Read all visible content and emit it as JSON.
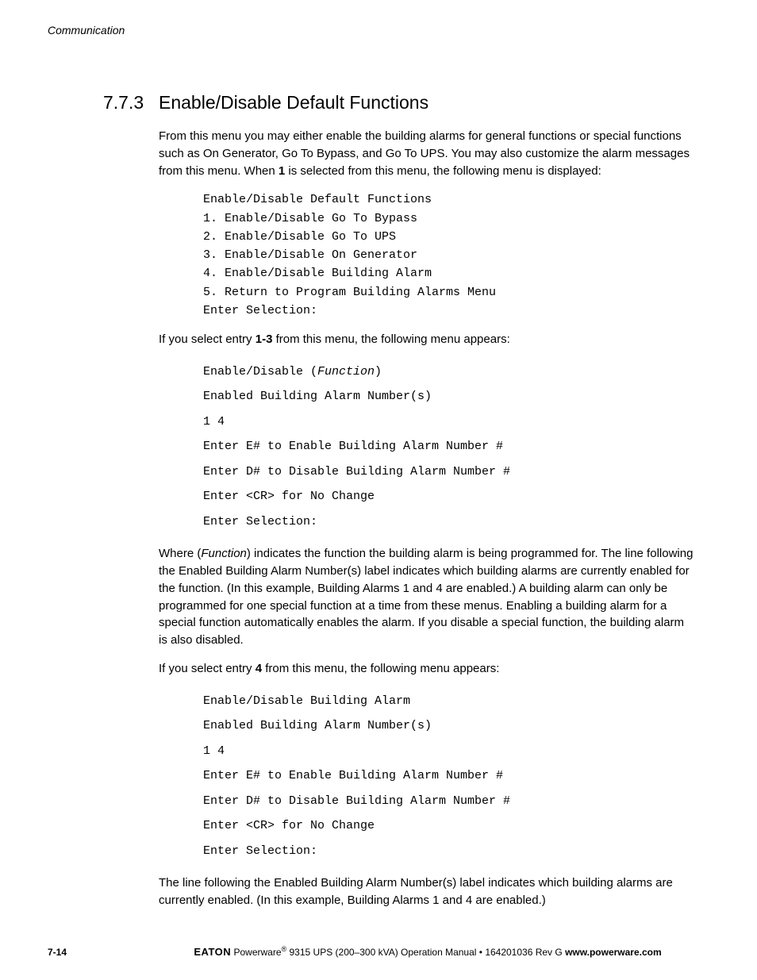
{
  "header": {
    "running": "Communication"
  },
  "section": {
    "number": "7.7.3",
    "title": "Enable/Disable Default Functions"
  },
  "para1": {
    "pre": "From this menu you may either enable the building alarms for general functions or special functions such as On Generator, Go To Bypass, and Go To UPS. You may also customize the alarm messages from this menu. When ",
    "bold": "1",
    "post": " is selected from this menu, the following menu is displayed:"
  },
  "menu1": {
    "l1": "Enable/Disable Default Functions",
    "l2": "1. Enable/Disable Go To Bypass",
    "l3": "2. Enable/Disable Go To UPS",
    "l4": "3. Enable/Disable On Generator",
    "l5": "4. Enable/Disable Building Alarm",
    "l6": "5. Return to Program Building Alarms Menu",
    "l7": "Enter Selection:"
  },
  "para2": {
    "pre": "If you select entry ",
    "bold": "1-3",
    "post": " from this menu, the following menu appears:"
  },
  "menu2": {
    "l1a": "Enable/Disable (",
    "l1b": "Function",
    "l1c": ")",
    "l2": "Enabled Building Alarm Number(s)",
    "l3": "1 4",
    "l4": "Enter E# to Enable Building Alarm Number #",
    "l5": "Enter D# to Disable Building Alarm Number #",
    "l6": "Enter <CR> for No Change",
    "l7": "Enter Selection:"
  },
  "para3": {
    "pre": "Where (",
    "italic": "Function",
    "post": ") indicates the function the building alarm is being programmed for. The line following the Enabled Building Alarm Number(s) label indicates which building alarms are currently enabled for the function. (In this example, Building Alarms 1 and 4 are enabled.) A building alarm can only be programmed for one special function at a time from these menus. Enabling a building alarm for a special function automatically enables the alarm. If you disable a special function, the building alarm is also disabled."
  },
  "para4": {
    "pre": "If you select entry ",
    "bold": "4",
    "post": " from this menu, the following menu appears:"
  },
  "menu3": {
    "l1": "Enable/Disable Building Alarm",
    "l2": "Enabled Building Alarm Number(s)",
    "l3": "1 4",
    "l4": "Enter E# to Enable Building Alarm Number #",
    "l5": "Enter D# to Disable Building Alarm Number #",
    "l6": "Enter <CR> for No Change",
    "l7": "Enter Selection:"
  },
  "para5": "The line following the Enabled Building Alarm Number(s) label indicates which building alarms are currently enabled. (In this example, Building Alarms 1 and 4 are enabled.)",
  "footer": {
    "page": "7-14",
    "brand": "EATON",
    "product_pre": " Powerware",
    "reg": "®",
    "product_post": " 9315 UPS (200–300 kVA) Operation Manual",
    "sep": "  •  ",
    "doc": "164201036 Rev G ",
    "url": "www.powerware.com"
  }
}
